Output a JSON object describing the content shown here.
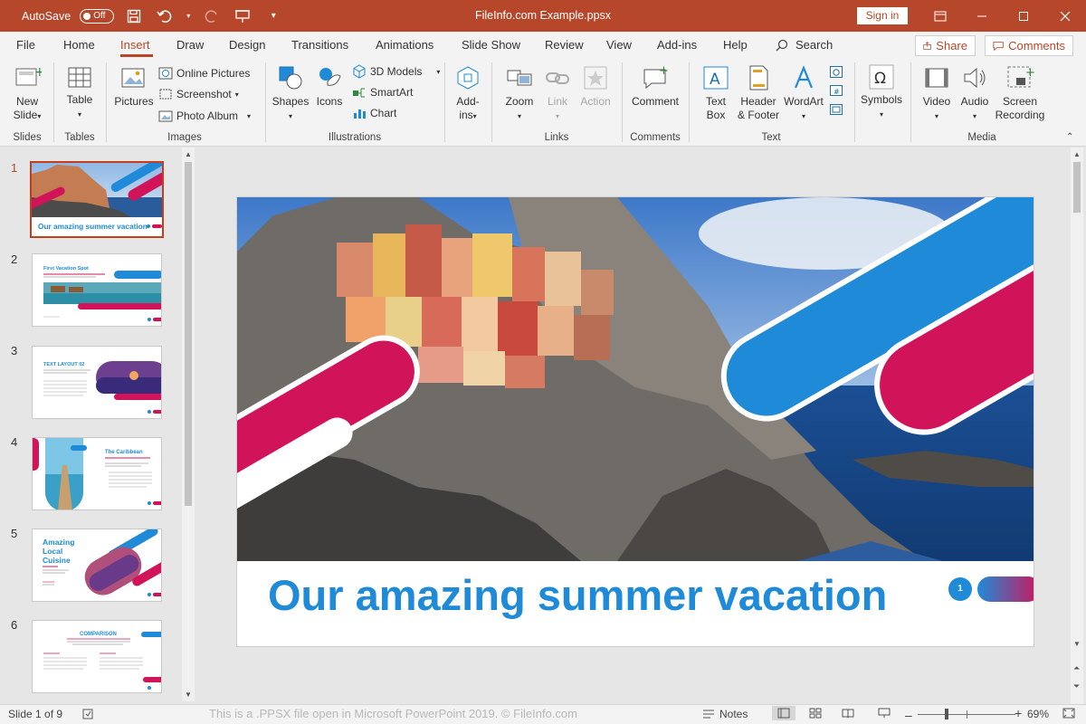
{
  "titlebar": {
    "autosave_label": "AutoSave",
    "autosave_state": "Off",
    "title": "FileInfo.com Example.ppsx",
    "signin_label": "Sign in",
    "accent": "#b7472a"
  },
  "tabs": [
    "File",
    "Home",
    "Insert",
    "Draw",
    "Design",
    "Transitions",
    "Animations",
    "Slide Show",
    "Review",
    "View",
    "Add-ins",
    "Help"
  ],
  "active_tab": "Insert",
  "search_label": "Search",
  "share_label": "Share",
  "comments_label": "Comments",
  "ribbon": {
    "new_slide": "New\nSlide",
    "table": "Table",
    "pictures": "Pictures",
    "online_pictures": "Online Pictures",
    "screenshot": "Screenshot",
    "photo_album": "Photo Album",
    "shapes": "Shapes",
    "icons": "Icons",
    "models_3d": "3D Models",
    "smartart": "SmartArt",
    "chart": "Chart",
    "addins": "Add-\nins",
    "zoom": "Zoom",
    "link": "Link",
    "action": "Action",
    "comment": "Comment",
    "text_box": "Text\nBox",
    "header_footer": "Header\n& Footer",
    "wordart": "WordArt",
    "symbols": "Symbols",
    "video": "Video",
    "audio": "Audio",
    "screen_recording": "Screen\nRecording",
    "groups": {
      "slides": "Slides",
      "tables": "Tables",
      "images": "Images",
      "illustrations": "Illustrations",
      "links": "Links",
      "comments": "Comments",
      "text": "Text",
      "media": "Media"
    }
  },
  "thumbnails": [
    {
      "num": "1",
      "title": "Our amazing summer vacation"
    },
    {
      "num": "2",
      "title": "First Vacation Spot"
    },
    {
      "num": "3",
      "title": "TEXT LAYOUT 02"
    },
    {
      "num": "4",
      "title": "The Caribbean"
    },
    {
      "num": "5",
      "title": "Amazing Local Cuisine"
    },
    {
      "num": "6",
      "title": "COMPARISON"
    }
  ],
  "slide": {
    "title": "Our amazing summer vacation",
    "number": "1",
    "blue": "#1f8bd8",
    "pink": "#d1145a"
  },
  "statusbar": {
    "slide_info": "Slide 1 of 9",
    "watermark": "This is a .PPSX file open in Microsoft PowerPoint 2019. © FileInfo.com",
    "notes": "Notes",
    "zoom": "69%"
  }
}
